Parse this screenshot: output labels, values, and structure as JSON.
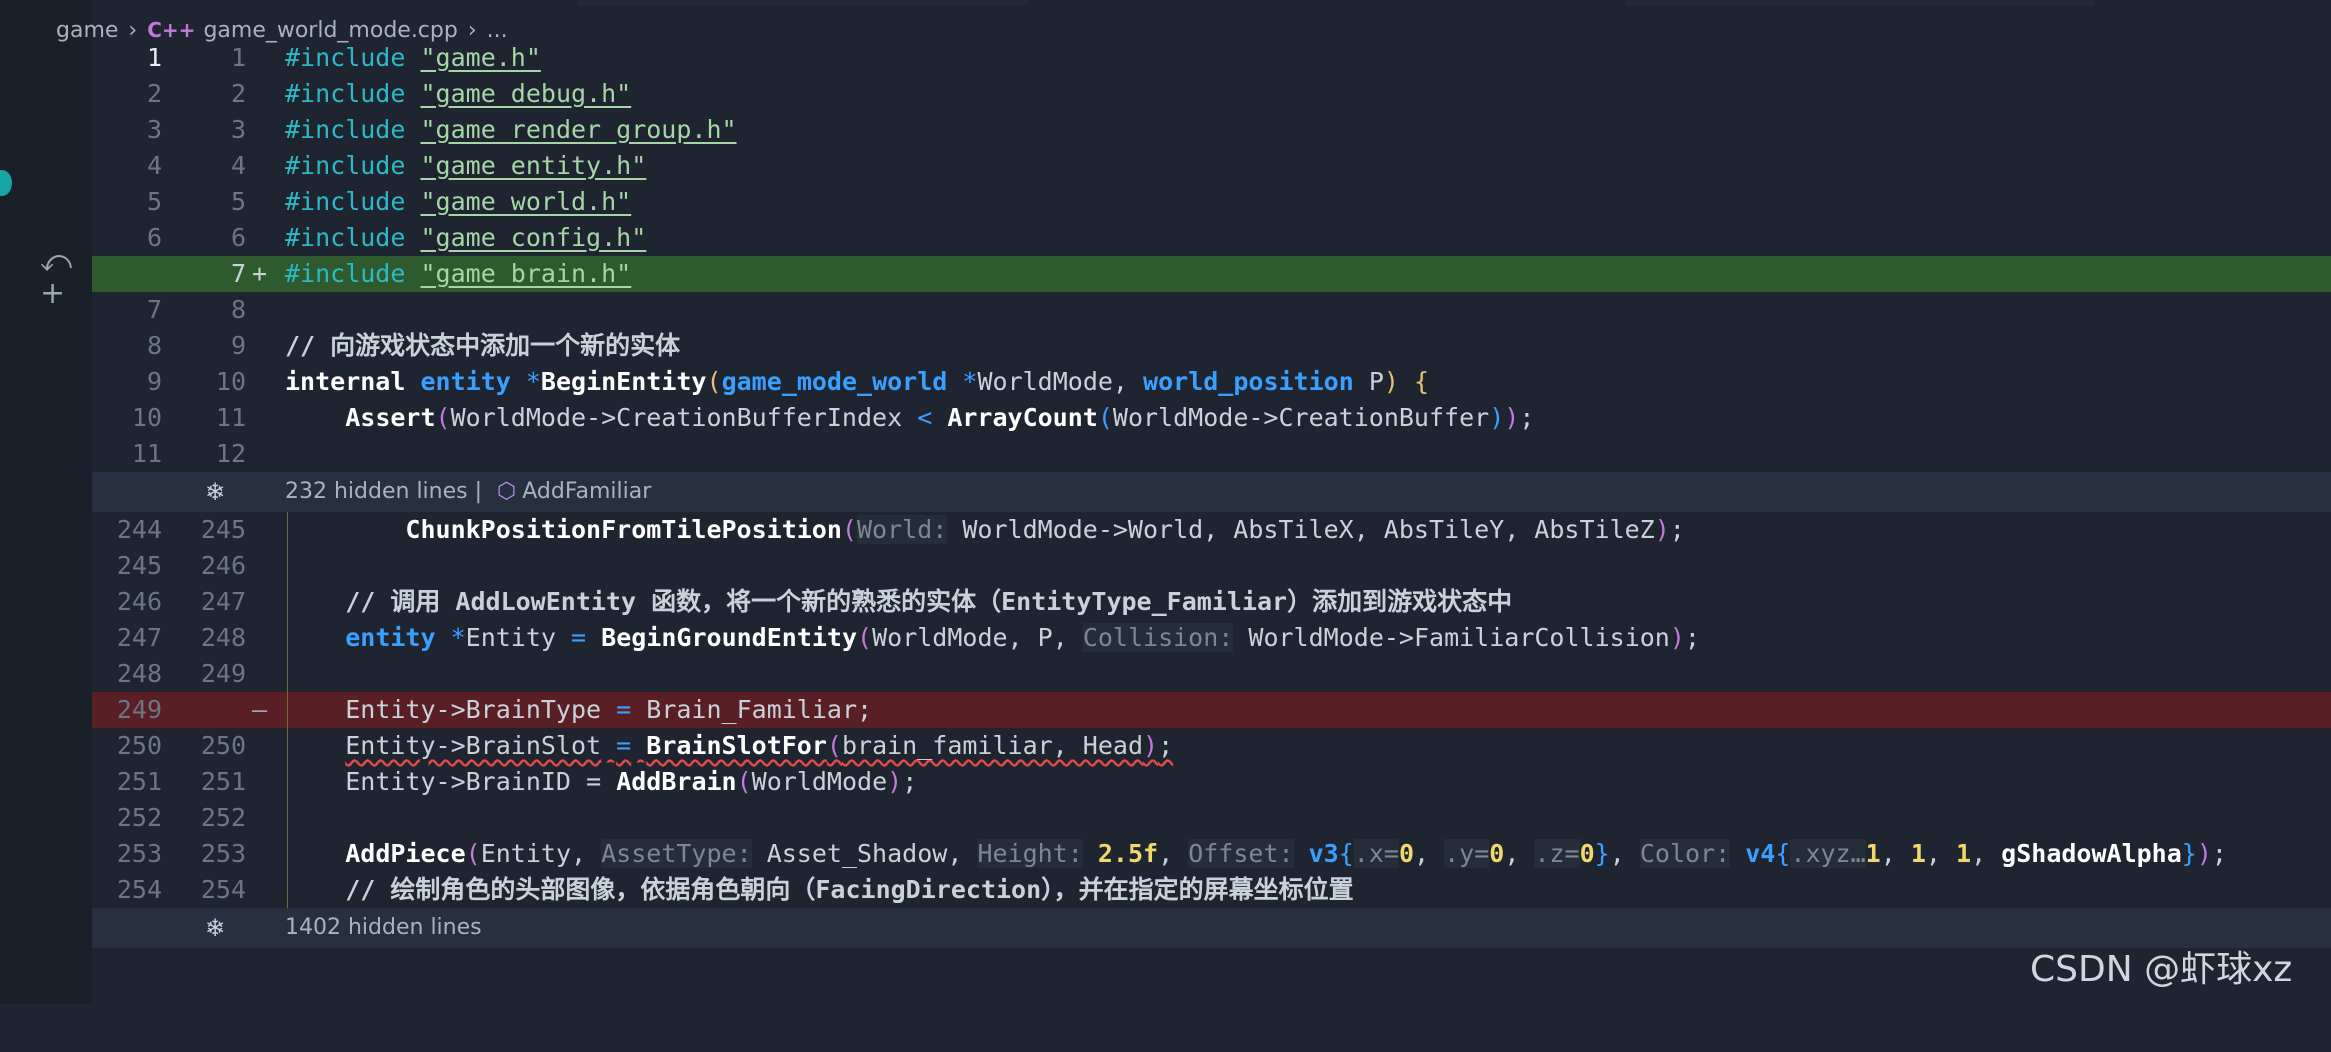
{
  "breadcrumb": {
    "folder": "game",
    "file": "game_world_mode.cpp",
    "more": "..."
  },
  "folds": [
    {
      "text": "232 hidden lines",
      "symbol": "AddFamiliar"
    },
    {
      "text": "1402 hidden lines"
    }
  ],
  "lines": [
    {
      "old": "1",
      "new": "1"
    },
    {
      "old": "2",
      "new": "2"
    },
    {
      "old": "3",
      "new": "3"
    },
    {
      "old": "4",
      "new": "4"
    },
    {
      "old": "5",
      "new": "5"
    },
    {
      "old": "6",
      "new": "6"
    },
    {
      "old": "",
      "new": "7",
      "marker": "+"
    },
    {
      "old": "7",
      "new": "8"
    },
    {
      "old": "8",
      "new": "9"
    },
    {
      "old": "9",
      "new": "10"
    },
    {
      "old": "10",
      "new": "11"
    },
    {
      "old": "11",
      "new": "12"
    },
    {
      "old": "244",
      "new": "245"
    },
    {
      "old": "245",
      "new": "246"
    },
    {
      "old": "246",
      "new": "247"
    },
    {
      "old": "247",
      "new": "248"
    },
    {
      "old": "248",
      "new": "249"
    },
    {
      "old": "249",
      "new": "",
      "marker": "—"
    },
    {
      "old": "250",
      "new": "250"
    },
    {
      "old": "251",
      "new": "251"
    },
    {
      "old": "252",
      "new": "252"
    },
    {
      "old": "253",
      "new": "253"
    },
    {
      "old": "254",
      "new": "254"
    }
  ],
  "code": {
    "inc": "#include",
    "s1": "\"game.h\"",
    "s2": "\"game_debug.h\"",
    "s3": "\"game_render_group.h\"",
    "s4": "\"game_entity.h\"",
    "s5": "\"game_world.h\"",
    "s6": "\"game_config.h\"",
    "s7": "\"game_brain.h\"",
    "c9": "// 向游戏状态中添加一个新的实体",
    "l10_kw": "internal",
    "l10_type": "entity",
    "l10_star": "*",
    "l10_fn": "BeginEntity",
    "l10_t2": "game_mode_world",
    "l10_a1": "WorldMode,",
    "l10_t3": "world_position",
    "l10_a2": "P",
    "l10_brace": "{",
    "l11_fn": "Assert",
    "l11_a": "WorldMode->CreationBufferIndex",
    "l11_lt": "<",
    "l11_fn2": "ArrayCount",
    "l11_b": "WorldMode->CreationBuffer",
    "l11_end": ";",
    "l245_fn": "ChunkPositionFromTilePosition",
    "l245_hint": "World:",
    "l245_args": "WorldMode->World, AbsTileX, AbsTileY, AbsTileZ",
    "l245_end": ";",
    "c247": "// 调用 AddLowEntity 函数，将一个新的熟悉的实体（EntityType_Familiar）添加到游戏状态中",
    "l248_type": "entity",
    "l248_star": "*",
    "l248_var": "Entity",
    "l248_eq": "=",
    "l248_fn": "BeginGroundEntity",
    "l248_args": "WorldMode, P,",
    "l248_hint": "Collision:",
    "l248_arg2": "WorldMode->FamiliarCollision",
    "l248_end": ";",
    "r249_a": "Entity->BrainType",
    "r249_eq": "=",
    "r249_b": "Brain_Familiar;",
    "l250_a": "Entity->BrainSlot",
    "l250_eq": "=",
    "l250_fn": "BrainSlotFor",
    "l250_args": "brain_familiar, Head",
    "l250_end": ";",
    "l251_a": "Entity->BrainID",
    "l251_eq": "=",
    "l251_fn": "AddBrain",
    "l251_args": "WorldMode",
    "l251_end": ";",
    "l253_fn": "AddPiece",
    "l253_a1": "Entity,",
    "l253_h1": "AssetType:",
    "l253_a2": "Asset_Shadow,",
    "l253_h2": "Height:",
    "l253_n1": "2.5f",
    "l253_c1": ",",
    "l253_h3": "Offset:",
    "l253_t1": "v3",
    "l253_x": ".x=",
    "l253_xv": "0",
    "l253_y": ".y=",
    "l253_yv": "0",
    "l253_z": ".z=",
    "l253_zv": "0",
    "l253_h4": "Color:",
    "l253_t2": "v4",
    "l253_xyz": ".xyz…",
    "l253_n2": "1",
    "l253_n3": "1",
    "l253_n4": "1",
    "l253_g": "gShadowAlpha",
    "l253_end": ";",
    "c254": "// 绘制角色的头部图像，依据角色朝向（FacingDirection），并在指定的屏幕坐标位置"
  },
  "watermark": "CSDN @虾球xz"
}
